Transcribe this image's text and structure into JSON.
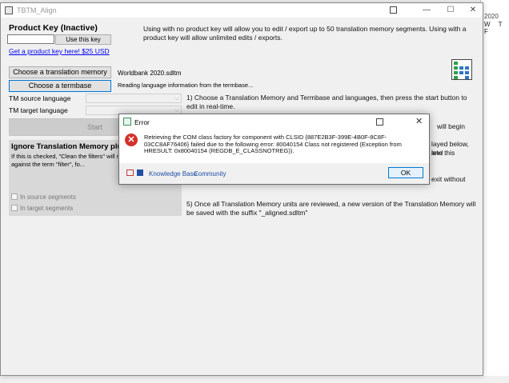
{
  "background": {
    "calendar_year": "2020",
    "calendar_days": "W T F"
  },
  "window": {
    "title": "TBTM_Align",
    "minimize": "—",
    "maximize": "☐",
    "close": "✕"
  },
  "product_key": {
    "title": "Product Key (Inactive)",
    "input_value": "",
    "use_button": "Use this key",
    "buy_link": "Get a product key here! $25 USD"
  },
  "intro_text": "Using with no product key will allow you to edit / export up to 50 translation memory segments.  Using with a product key will allow unlimited edits / exports.",
  "tm": {
    "choose_tm_button": "Choose a translation memory",
    "tm_file": "Worldbank 2020.sdltm",
    "choose_tb_button": "Choose a termbase",
    "tb_status": "Reading language information from the termbase..."
  },
  "languages": {
    "source_label": "TM source language",
    "target_label": "TM target language",
    "source_value": "",
    "target_value": ""
  },
  "start_button": "Start",
  "plurals": {
    "title": "Ignore Translation Memory plurals?",
    "text": "If this is checked, \"Clean the filters\" will no... when compared against the term \"filter\", fo...",
    "source_cb": "In source segments",
    "target_cb": "In target segments"
  },
  "steps": {
    "step1": "1) Choose a Translation Memory and Termbase and languages, then press the start button to edit in real-time.",
    "step2_tail": "will begin",
    "step3_tail_a": "layed below, and",
    "step3_tail_b": "lete this",
    "step4_tail": "exit without",
    "step5": "5) Once all Translation Memory units are reviewed, a new version of the Translation Memory will be saved with the suffix \"_aligned.sdltm\""
  },
  "error_dialog": {
    "title": "Error",
    "close": "✕",
    "icon": "✕",
    "message": "Retrieving the COM class factory for component with CLSID {887E2B3F-399E-4B0F-8C8F-03CC8AF76406} failed due to the following error: 80040154 Class not registered (Exception from HRESULT: 0x80040154 (REGDB_E_CLASSNOTREG)).",
    "kb_link": "Knowledge Base",
    "community_link": "Community",
    "ok_button": "OK"
  },
  "colors": {
    "accent": "#0078d7",
    "error": "#d3312b",
    "link": "#1f4ea5"
  }
}
